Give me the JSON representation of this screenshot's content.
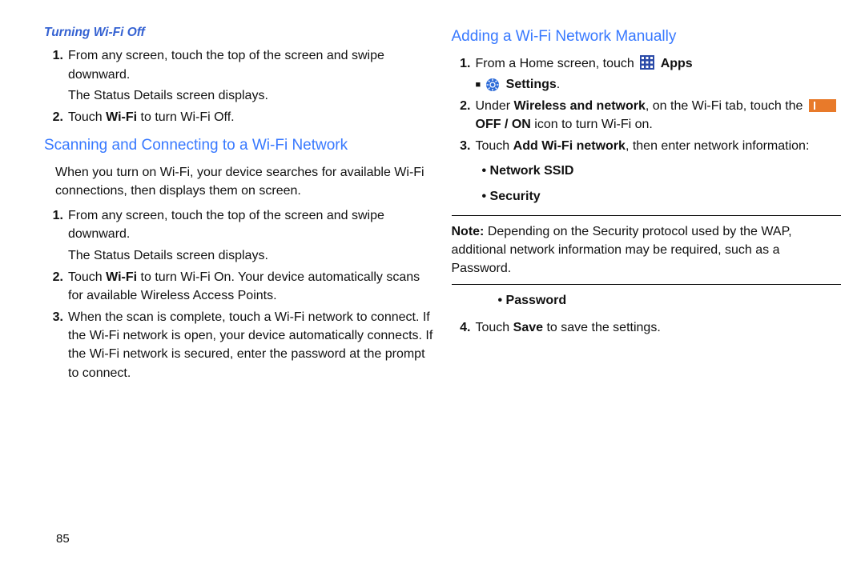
{
  "pageNumber": "85",
  "left": {
    "h1": "Turning Wi-Fi Off",
    "list1": {
      "i1": "From any screen, touch the top of the screen and swipe downward.",
      "i1b": "The Status Details screen displays.",
      "i2a": "Touch ",
      "i2b": "Wi-Fi",
      "i2c": " to turn Wi-Fi Off."
    },
    "h2": "Scanning and Connecting to a Wi-Fi Network",
    "intro": "When you turn on Wi-Fi, your device searches for available Wi-Fi connections, then displays them on screen.",
    "list2": {
      "i1": "From any screen, touch the top of the screen and swipe downward.",
      "i1b": "The Status Details screen displays.",
      "i2a": "Touch ",
      "i2b": "Wi-Fi",
      "i2c": " to turn Wi-Fi On. Your device automatically scans for available Wireless Access Points.",
      "i3": "When the scan is complete, touch a Wi-Fi network to connect. If the Wi-Fi network is open, your device automatically connects. If the Wi-Fi network is secured, enter the password at the prompt to connect."
    }
  },
  "right": {
    "h1": "Adding a Wi-Fi Network Manually",
    "list": {
      "i1a": "From a Home screen, touch ",
      "i1apps": " Apps",
      "i1settings": "Settings",
      "i2a": "Under ",
      "i2b": "Wireless and network",
      "i2c": ", on the Wi-Fi tab, touch the ",
      "i2d": " OFF / ON",
      "i2e": " icon to turn Wi-Fi on.",
      "i3a": "Touch ",
      "i3b": "Add Wi-Fi network",
      "i3c": ", then enter network information:",
      "bul1": "Network SSID",
      "bul2": "Security",
      "noteLabel": "Note:",
      "note": " Depending on the Security protocol used by the WAP, additional network information may be required, such as a Password.",
      "bul3": "Password",
      "i4a": "Touch ",
      "i4b": "Save",
      "i4c": " to save the settings."
    }
  }
}
